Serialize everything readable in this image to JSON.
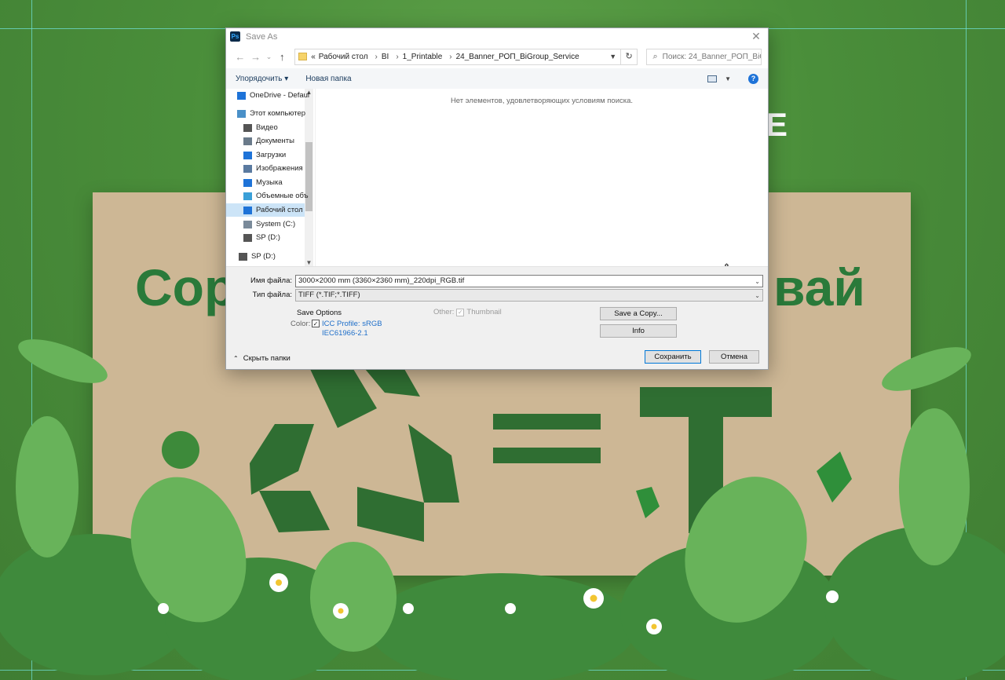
{
  "background": {
    "headline_left": "Сор",
    "headline_right": "вай",
    "white_letter": "E"
  },
  "dialog": {
    "app_badge": "Ps",
    "title": "Save As",
    "close_glyph": "✕",
    "nav": {
      "back": "←",
      "forward": "→",
      "recent": "⌄",
      "up": "↑"
    },
    "address": {
      "overflow": "«",
      "crumbs": [
        "Рабочий стол",
        "BI",
        "1_Printable",
        "24_Banner_РОП_BiGroup_Service"
      ],
      "separator": "›"
    },
    "search_placeholder": "Поиск: 24_Banner_РОП_BiG...",
    "toolbar": {
      "organize": "Упорядочить ▾",
      "new_folder": "Новая папка",
      "help": "?"
    },
    "nav_pane": {
      "items": [
        {
          "label": "OneDrive - Defaul",
          "icon": "cloud-icon",
          "color": "#1e73d8"
        },
        {
          "label": "Этот компьютер",
          "icon": "computer-icon",
          "color": "#4a90c8"
        },
        {
          "label": "Видео",
          "icon": "video-icon",
          "color": "#555555"
        },
        {
          "label": "Документы",
          "icon": "documents-icon",
          "color": "#6a7a8a"
        },
        {
          "label": "Загрузки",
          "icon": "downloads-icon",
          "color": "#1e73d8"
        },
        {
          "label": "Изображения",
          "icon": "pictures-icon",
          "color": "#5a7aa0"
        },
        {
          "label": "Музыка",
          "icon": "music-icon",
          "color": "#1e73d8"
        },
        {
          "label": "Объемные объ",
          "icon": "3d-objects-icon",
          "color": "#3aa0d8"
        },
        {
          "label": "Рабочий стол",
          "icon": "desktop-icon",
          "color": "#1e73d8"
        },
        {
          "label": "System (C:)",
          "icon": "drive-c-icon",
          "color": "#7a8a9a"
        },
        {
          "label": "SP (D:)",
          "icon": "drive-d-icon",
          "color": "#555555"
        },
        {
          "label": "SP (D:)",
          "icon": "drive-d-icon",
          "color": "#555555"
        }
      ],
      "selected_index": 8
    },
    "empty_message": "Нет элементов, удовлетворяющих условиям поиска.",
    "filename_label": "Имя файла:",
    "filename_value": "3000×2000 mm (3360×2360 mm)_220dpi_RGB.tif",
    "filetype_label": "Тип файла:",
    "filetype_value": "TIFF (*.TIF;*.TIFF)",
    "save_options": {
      "title": "Save Options",
      "color_label": "Color:",
      "icc_line1": "ICC Profile:  sRGB",
      "icc_line2": "IEC61966-2.1",
      "icc_checked": true,
      "other_label": "Other:",
      "thumbnail_label": "Thumbnail",
      "thumbnail_checked": true
    },
    "buttons": {
      "save_copy": "Save a Copy...",
      "info": "Info",
      "save": "Сохранить",
      "cancel": "Отмена"
    },
    "hide_folders": "Скрыть папки"
  }
}
